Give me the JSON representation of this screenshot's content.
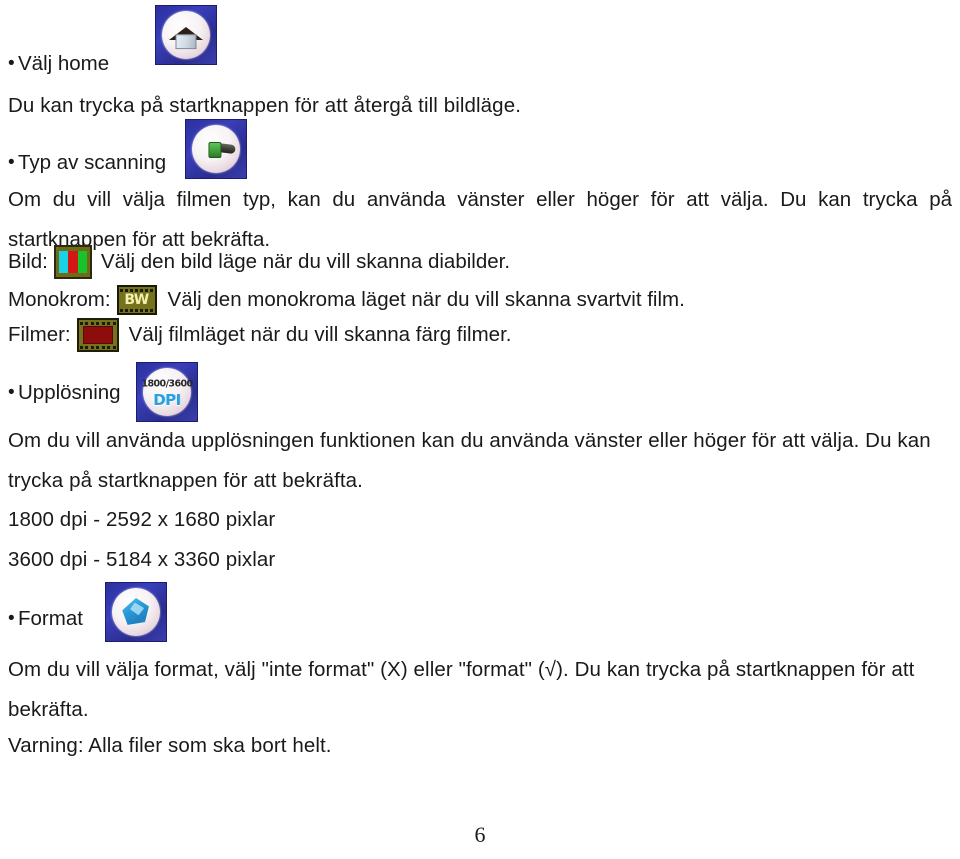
{
  "document": {
    "page_number": "6",
    "sections": [
      {
        "id": "home",
        "bullet": "•",
        "heading": "Välj home",
        "icon": "home-icon",
        "body": "Du kan trycka på startknappen för att återgå till bildläge."
      },
      {
        "id": "scan-type",
        "bullet": "•",
        "heading": "Typ av scanning",
        "icon": "film-scan-icon",
        "body": "Om du vill välja filmen typ, kan du använda vänster eller höger för att välja. Du kan trycka på startknappen för att bekräfta."
      },
      {
        "id": "resolution",
        "bullet": "•",
        "heading": "Upplösning",
        "icon": "dpi-icon",
        "body": "Om du vill använda upplösningen funktionen kan du använda vänster eller höger för att välja. Du kan trycka på startknappen för att bekräfta."
      },
      {
        "id": "format",
        "bullet": "•",
        "heading": "Format",
        "icon": "gem-format-icon",
        "body": "Om du vill välja format, välj \"inte format\" (X) eller \"format\" (√). Du kan trycka på startknappen för att bekräfta."
      }
    ],
    "scan_modes": [
      {
        "label": "Bild:",
        "icon": "slide-photo-icon",
        "description": "Välj den bild läge när du vill skanna diabilder."
      },
      {
        "label": "Monokrom:",
        "icon": "bw-film-icon",
        "icon_text": "BW",
        "description": "Välj den monokroma läget när du vill skanna svartvit film."
      },
      {
        "label": "Filmer:",
        "icon": "color-film-icon",
        "description": "Välj filmläget när du vill skanna färg filmer."
      }
    ],
    "resolution_list": [
      "1800 dpi - 2592 x 1680 pixlar",
      "3600 dpi - 5184 x 3360 pixlar"
    ],
    "warning": "Varning: Alla filer som ska bort helt.",
    "icon_labels": {
      "dpi_top": "1800/3600",
      "dpi_bottom": "DPI"
    },
    "colors": {
      "text": "#1a1a1a",
      "icon_bg_blue": "#2b2f9e",
      "film_olive": "#76721b",
      "film_red": "#8d0d0d",
      "dpi_cyan": "#2a9fe0",
      "slide_cyan": "#16d3e6",
      "slide_red": "#d31717",
      "slide_green": "#17c42a"
    }
  }
}
